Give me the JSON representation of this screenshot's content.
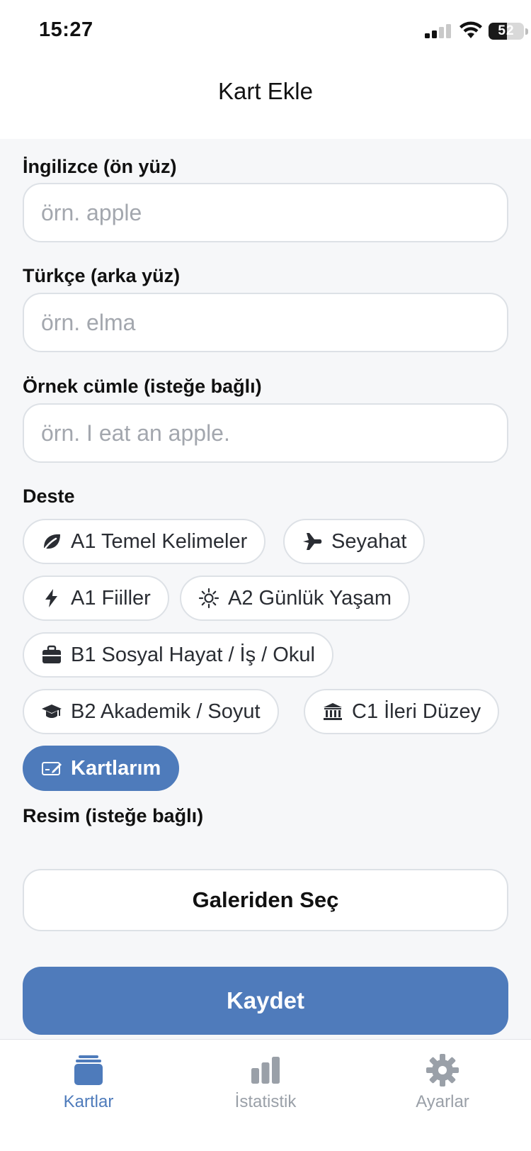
{
  "status_bar": {
    "time": "15:27",
    "battery_level": "52",
    "icons": [
      "cellular-signal-icon",
      "wifi-icon",
      "battery-icon"
    ]
  },
  "nav": {
    "title": "Kart Ekle"
  },
  "form": {
    "front": {
      "label": "İngilizce (ön yüz)",
      "placeholder": "örn. apple",
      "value": ""
    },
    "back": {
      "label": "Türkçe (arka yüz)",
      "placeholder": "örn. elma",
      "value": ""
    },
    "example": {
      "label": "Örnek cümle (isteğe bağlı)",
      "placeholder": "örn. I eat an apple.",
      "value": ""
    },
    "deck": {
      "label": "Deste",
      "options": [
        {
          "label": "A1 Temel Kelimeler",
          "icon": "leaf-icon",
          "selected": false
        },
        {
          "label": "Seyahat",
          "icon": "airplane-icon",
          "selected": false
        },
        {
          "label": "A1 Fiiller",
          "icon": "lightning-icon",
          "selected": false
        },
        {
          "label": "A2 Günlük Yaşam",
          "icon": "sun-icon",
          "selected": false
        },
        {
          "label": "B1 Sosyal Hayat / İş / Okul",
          "icon": "briefcase-icon",
          "selected": false
        },
        {
          "label": "B2 Akademik / Soyut",
          "icon": "graduation-cap-icon",
          "selected": false
        },
        {
          "label": "C1 İleri Düzey",
          "icon": "institution-icon",
          "selected": false
        },
        {
          "label": "Kartlarım",
          "icon": "edit-card-icon",
          "selected": true
        }
      ]
    },
    "image": {
      "label": "Resim (isteğe bağlı)",
      "button": "Galeriden Seç"
    },
    "save": "Kaydet"
  },
  "tabbar": {
    "tabs": [
      {
        "label": "Kartlar",
        "icon": "cards-icon",
        "active": true
      },
      {
        "label": "İstatistik",
        "icon": "bar-chart-icon",
        "active": false
      },
      {
        "label": "Ayarlar",
        "icon": "gear-icon",
        "active": false
      }
    ]
  },
  "colors": {
    "accent": "#4E7BBB",
    "background": "#F6F7F9",
    "inactive_tab": "#9AA0A8"
  }
}
